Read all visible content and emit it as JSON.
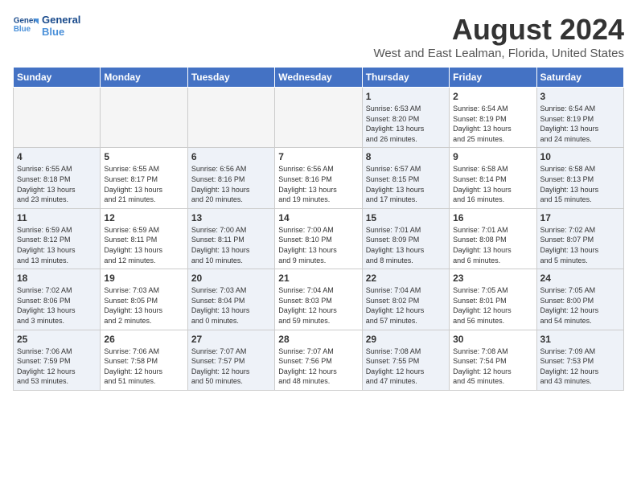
{
  "logo": {
    "name_line1": "General",
    "name_line2": "Blue"
  },
  "title": "August 2024",
  "subtitle": "West and East Lealman, Florida, United States",
  "days_of_week": [
    "Sunday",
    "Monday",
    "Tuesday",
    "Wednesday",
    "Thursday",
    "Friday",
    "Saturday"
  ],
  "weeks": [
    [
      {
        "day": "",
        "data": ""
      },
      {
        "day": "",
        "data": ""
      },
      {
        "day": "",
        "data": ""
      },
      {
        "day": "",
        "data": ""
      },
      {
        "day": "1",
        "data": "Sunrise: 6:53 AM\nSunset: 8:20 PM\nDaylight: 13 hours\nand 26 minutes."
      },
      {
        "day": "2",
        "data": "Sunrise: 6:54 AM\nSunset: 8:19 PM\nDaylight: 13 hours\nand 25 minutes."
      },
      {
        "day": "3",
        "data": "Sunrise: 6:54 AM\nSunset: 8:19 PM\nDaylight: 13 hours\nand 24 minutes."
      }
    ],
    [
      {
        "day": "4",
        "data": "Sunrise: 6:55 AM\nSunset: 8:18 PM\nDaylight: 13 hours\nand 23 minutes."
      },
      {
        "day": "5",
        "data": "Sunrise: 6:55 AM\nSunset: 8:17 PM\nDaylight: 13 hours\nand 21 minutes."
      },
      {
        "day": "6",
        "data": "Sunrise: 6:56 AM\nSunset: 8:16 PM\nDaylight: 13 hours\nand 20 minutes."
      },
      {
        "day": "7",
        "data": "Sunrise: 6:56 AM\nSunset: 8:16 PM\nDaylight: 13 hours\nand 19 minutes."
      },
      {
        "day": "8",
        "data": "Sunrise: 6:57 AM\nSunset: 8:15 PM\nDaylight: 13 hours\nand 17 minutes."
      },
      {
        "day": "9",
        "data": "Sunrise: 6:58 AM\nSunset: 8:14 PM\nDaylight: 13 hours\nand 16 minutes."
      },
      {
        "day": "10",
        "data": "Sunrise: 6:58 AM\nSunset: 8:13 PM\nDaylight: 13 hours\nand 15 minutes."
      }
    ],
    [
      {
        "day": "11",
        "data": "Sunrise: 6:59 AM\nSunset: 8:12 PM\nDaylight: 13 hours\nand 13 minutes."
      },
      {
        "day": "12",
        "data": "Sunrise: 6:59 AM\nSunset: 8:11 PM\nDaylight: 13 hours\nand 12 minutes."
      },
      {
        "day": "13",
        "data": "Sunrise: 7:00 AM\nSunset: 8:11 PM\nDaylight: 13 hours\nand 10 minutes."
      },
      {
        "day": "14",
        "data": "Sunrise: 7:00 AM\nSunset: 8:10 PM\nDaylight: 13 hours\nand 9 minutes."
      },
      {
        "day": "15",
        "data": "Sunrise: 7:01 AM\nSunset: 8:09 PM\nDaylight: 13 hours\nand 8 minutes."
      },
      {
        "day": "16",
        "data": "Sunrise: 7:01 AM\nSunset: 8:08 PM\nDaylight: 13 hours\nand 6 minutes."
      },
      {
        "day": "17",
        "data": "Sunrise: 7:02 AM\nSunset: 8:07 PM\nDaylight: 13 hours\nand 5 minutes."
      }
    ],
    [
      {
        "day": "18",
        "data": "Sunrise: 7:02 AM\nSunset: 8:06 PM\nDaylight: 13 hours\nand 3 minutes."
      },
      {
        "day": "19",
        "data": "Sunrise: 7:03 AM\nSunset: 8:05 PM\nDaylight: 13 hours\nand 2 minutes."
      },
      {
        "day": "20",
        "data": "Sunrise: 7:03 AM\nSunset: 8:04 PM\nDaylight: 13 hours\nand 0 minutes."
      },
      {
        "day": "21",
        "data": "Sunrise: 7:04 AM\nSunset: 8:03 PM\nDaylight: 12 hours\nand 59 minutes."
      },
      {
        "day": "22",
        "data": "Sunrise: 7:04 AM\nSunset: 8:02 PM\nDaylight: 12 hours\nand 57 minutes."
      },
      {
        "day": "23",
        "data": "Sunrise: 7:05 AM\nSunset: 8:01 PM\nDaylight: 12 hours\nand 56 minutes."
      },
      {
        "day": "24",
        "data": "Sunrise: 7:05 AM\nSunset: 8:00 PM\nDaylight: 12 hours\nand 54 minutes."
      }
    ],
    [
      {
        "day": "25",
        "data": "Sunrise: 7:06 AM\nSunset: 7:59 PM\nDaylight: 12 hours\nand 53 minutes."
      },
      {
        "day": "26",
        "data": "Sunrise: 7:06 AM\nSunset: 7:58 PM\nDaylight: 12 hours\nand 51 minutes."
      },
      {
        "day": "27",
        "data": "Sunrise: 7:07 AM\nSunset: 7:57 PM\nDaylight: 12 hours\nand 50 minutes."
      },
      {
        "day": "28",
        "data": "Sunrise: 7:07 AM\nSunset: 7:56 PM\nDaylight: 12 hours\nand 48 minutes."
      },
      {
        "day": "29",
        "data": "Sunrise: 7:08 AM\nSunset: 7:55 PM\nDaylight: 12 hours\nand 47 minutes."
      },
      {
        "day": "30",
        "data": "Sunrise: 7:08 AM\nSunset: 7:54 PM\nDaylight: 12 hours\nand 45 minutes."
      },
      {
        "day": "31",
        "data": "Sunrise: 7:09 AM\nSunset: 7:53 PM\nDaylight: 12 hours\nand 43 minutes."
      }
    ]
  ]
}
